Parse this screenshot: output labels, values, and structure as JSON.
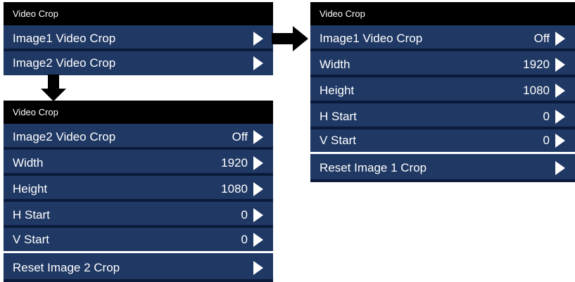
{
  "panel_a": {
    "header": "Video Crop",
    "rows": [
      {
        "label": "Image1 Video Crop",
        "value": ""
      },
      {
        "label": "Image2 Video Crop",
        "value": ""
      }
    ]
  },
  "panel_b": {
    "header": "Video Crop",
    "rows": [
      {
        "label": "Image1 Video Crop",
        "value": "Off"
      },
      {
        "label": "Width",
        "value": "1920"
      },
      {
        "label": "Height",
        "value": "1080"
      },
      {
        "label": "H Start",
        "value": "0"
      },
      {
        "label": "V Start",
        "value": "0"
      },
      {
        "label": "Reset Image 1  Crop",
        "value": ""
      }
    ]
  },
  "panel_c": {
    "header": "Video Crop",
    "rows": [
      {
        "label": "Image2 Video Crop",
        "value": "Off"
      },
      {
        "label": "Width",
        "value": "1920"
      },
      {
        "label": "Height",
        "value": "1080"
      },
      {
        "label": "H Start",
        "value": "0"
      },
      {
        "label": "V Start",
        "value": "0"
      },
      {
        "label": "Reset Image 2 Crop",
        "value": ""
      }
    ]
  },
  "colors": {
    "header_bg": "#000000",
    "row_bg": "#1f3864",
    "row_separator": "#0b1a3a",
    "text": "#ffffff"
  }
}
